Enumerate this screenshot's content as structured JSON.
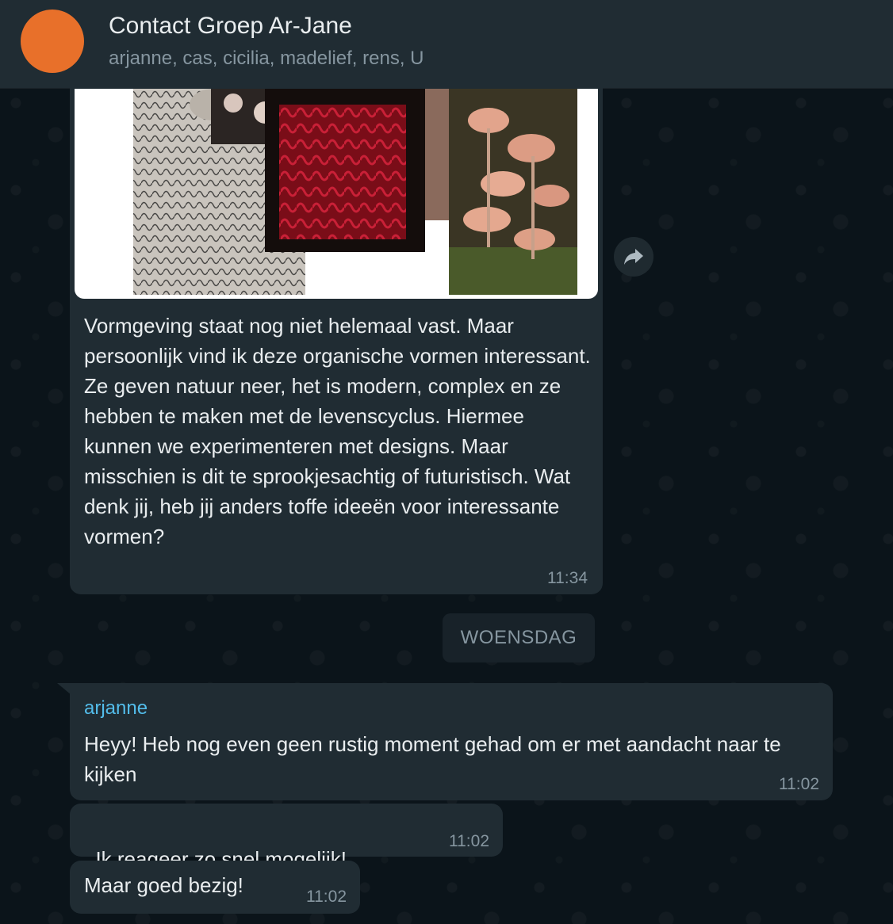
{
  "header": {
    "title": "Contact Groep Ar-Jane",
    "members": "arjanne, cas, cicilia, madelief, rens, U",
    "avatar_color": "#e8702a"
  },
  "messages": [
    {
      "type": "image",
      "caption": "Vormgeving staat nog niet helemaal vast. Maar persoonlijk vind ik deze organische vormen interessant. Ze geven natuur neer, het is modern, complex en ze hebben te maken met de levenscyclus. Hiermee kunnen we experimenteren met designs. Maar misschien is dit te sprookjesachtig of futuristisch. Wat denk jij, heb jij anders toffe ideeën voor interessante vormen?",
      "time": "11:34",
      "forward_icon": "forward-arrow-icon"
    },
    {
      "type": "text",
      "sender": "arjanne",
      "text": "Heyy! Heb nog even geen rustig moment gehad om er met aandacht naar te kijken",
      "time": "11:02"
    },
    {
      "type": "text",
      "text": "Ik reageer zo snel mogelijk!",
      "emoji": "👍🏼",
      "time": "11:02"
    },
    {
      "type": "text",
      "text": "Maar goed bezig!",
      "time": "11:02"
    }
  ],
  "day_separator": "WOENSDAG",
  "colors": {
    "bubble": "#202c33",
    "sender_name": "#53bdeb",
    "background": "#0b141a"
  }
}
